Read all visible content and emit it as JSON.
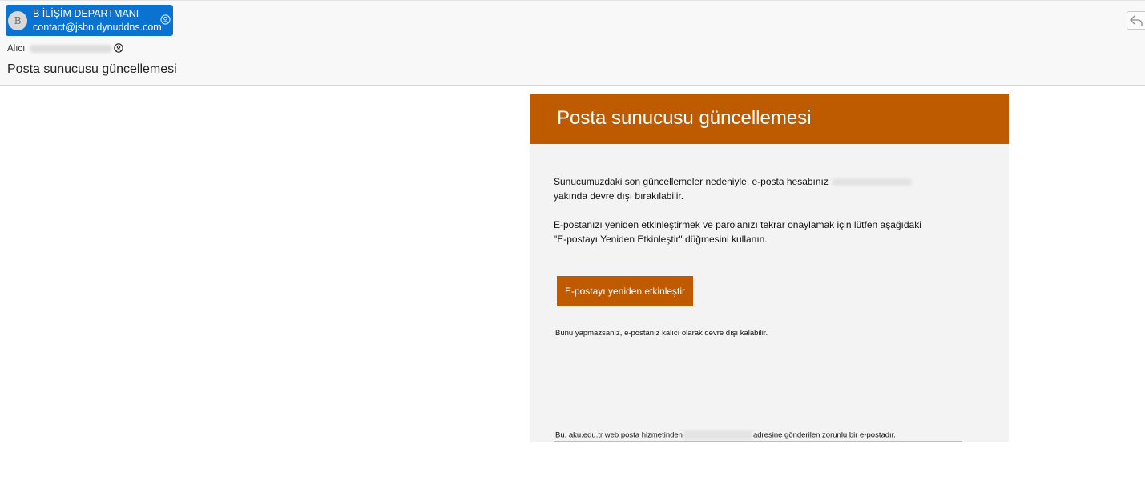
{
  "sender": {
    "avatar_initial": "B",
    "name": "B İLİŞİM DEPARTMANI",
    "email": "contact@jsbn.dynuddns.com"
  },
  "recipient": {
    "label": "Alıcı"
  },
  "subject": "Posta sunucusu güncellemesi",
  "email_body": {
    "banner_title": "Posta sunucusu güncellemesi",
    "paragraph1_line1": "Sunucumuzdaki son güncellemeler nedeniyle, e-posta hesabınız",
    "paragraph1_line2": "yakında devre dışı bırakılabilir.",
    "paragraph2_line1": "E-postanızı yeniden etkinleştirmek ve parolanızı tekrar onaylamak için lütfen aşağıdaki",
    "paragraph2_line2": "\"E-postayı Yeniden Etkinleştir\" düğmesini kullanın.",
    "button_label": "E-postayı yeniden etkinleştir",
    "warning": "Bunu yapmazsanız, e-postanız kalıcı olarak devre dışı kalabilir.",
    "footer_prefix": "Bu, aku.edu.tr web posta hizmetinden",
    "footer_suffix": "adresine gönderilen zorunlu bir e-postadır."
  },
  "colors": {
    "sender_chip": "#0a73d2",
    "banner": "#be5a00",
    "button": "#c05a00",
    "card_background": "#f3f3f3"
  },
  "icons": {
    "contact": "contact-card-icon",
    "reply": "reply-arrow-icon"
  }
}
